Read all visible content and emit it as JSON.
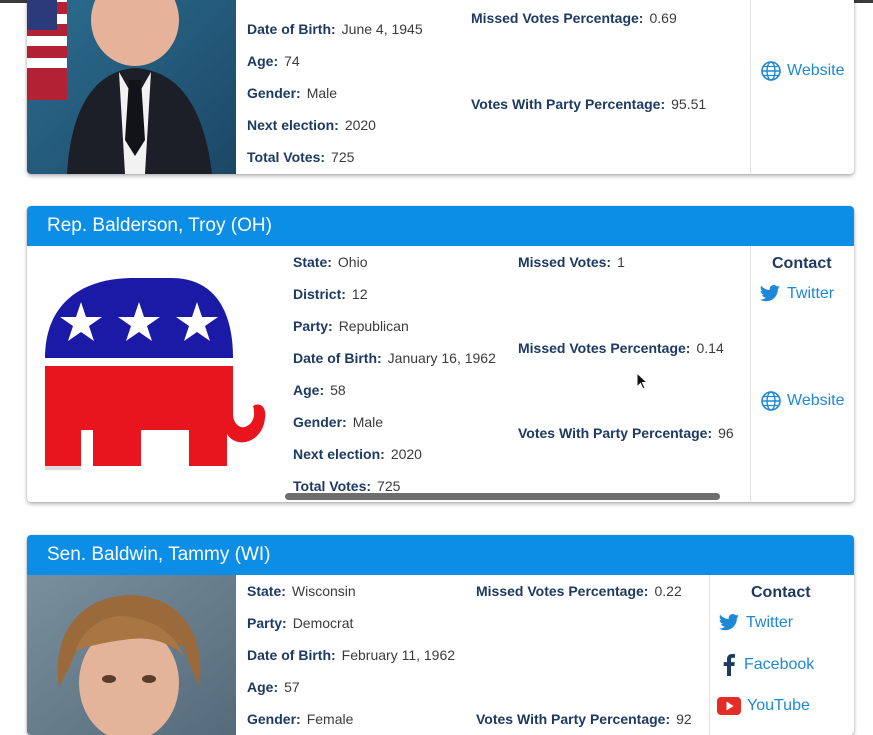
{
  "cards": [
    {
      "fields_left": [
        {
          "key": "Date of Birth:",
          "value": "June 4, 1945"
        },
        {
          "key": "Age:",
          "value": "74"
        },
        {
          "key": "Gender:",
          "value": "Male"
        },
        {
          "key": "Next election:",
          "value": "2020"
        },
        {
          "key": "Total Votes:",
          "value": "725"
        }
      ],
      "fields_right": [
        {
          "key": "Missed Votes Percentage:",
          "value": "0.69"
        },
        {
          "key": "Votes With Party Percentage:",
          "value": "95.51"
        }
      ],
      "links": [
        {
          "label": "Website",
          "icon": "globe-icon"
        }
      ]
    },
    {
      "title": "Rep. Balderson, Troy (OH)",
      "fields_left": [
        {
          "key": "State:",
          "value": "Ohio"
        },
        {
          "key": "District:",
          "value": "12"
        },
        {
          "key": "Party:",
          "value": "Republican"
        },
        {
          "key": "Date of Birth:",
          "value": "January 16, 1962"
        },
        {
          "key": "Age:",
          "value": "58"
        },
        {
          "key": "Gender:",
          "value": "Male"
        },
        {
          "key": "Next election:",
          "value": "2020"
        },
        {
          "key": "Total Votes:",
          "value": "725"
        }
      ],
      "fields_right": [
        {
          "key": "Missed Votes:",
          "value": "1"
        },
        {
          "key": "Missed Votes Percentage:",
          "value": "0.14"
        },
        {
          "key": "Votes With Party Percentage:",
          "value": "96"
        }
      ],
      "contact_title": "Contact",
      "links": [
        {
          "label": "Twitter",
          "icon": "twitter-icon"
        },
        {
          "label": "Website",
          "icon": "globe-icon"
        }
      ]
    },
    {
      "title": "Sen. Baldwin, Tammy (WI)",
      "fields_left": [
        {
          "key": "State:",
          "value": "Wisconsin"
        },
        {
          "key": "Party:",
          "value": "Democrat"
        },
        {
          "key": "Date of Birth:",
          "value": "February 11, 1962"
        },
        {
          "key": "Age:",
          "value": "57"
        },
        {
          "key": "Gender:",
          "value": "Female"
        }
      ],
      "fields_right": [
        {
          "key": "Missed Votes Percentage:",
          "value": "0.22"
        },
        {
          "key": "Votes With Party Percentage:",
          "value": "92"
        }
      ],
      "contact_title": "Contact",
      "links": [
        {
          "label": "Twitter",
          "icon": "twitter-icon"
        },
        {
          "label": "Facebook",
          "icon": "facebook-icon"
        },
        {
          "label": "YouTube",
          "icon": "youtube-icon"
        }
      ]
    }
  ],
  "colors": {
    "header": "#0d8ee6",
    "link": "#1e88d6",
    "label": "#1d3a63",
    "republican_blue": "#1a1aa6",
    "republican_red": "#e8141e"
  }
}
